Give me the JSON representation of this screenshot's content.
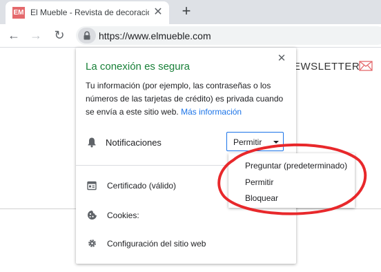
{
  "browser": {
    "tab": {
      "favicon_text": "EM",
      "title": "El Mueble - Revista de decoración",
      "close_glyph": "✕"
    },
    "new_tab_glyph": "+",
    "nav": {
      "back_glyph": "←",
      "forward_glyph": "→",
      "reload_glyph": "↻"
    },
    "url": "https://www.elmueble.com"
  },
  "page": {
    "newsletter_text": "EWSLETTER"
  },
  "popup": {
    "close_glyph": "✕",
    "title": "La conexión es segura",
    "description": "Tu información (por ejemplo, las contraseñas o los números de las tarjetas de crédito) es privada cuando se envía a este sitio web. ",
    "more_info_link": "Más información",
    "notifications_label": "Notificaciones",
    "notifications_value": "Permitir",
    "certificate_label": "Certificado (válido)",
    "cookies_label": "Cookies:",
    "site_settings_label": "Configuración del sitio web"
  },
  "dropdown": {
    "options": [
      "Preguntar (predeterminado)",
      "Permitir",
      "Bloquear"
    ]
  },
  "colors": {
    "secure_green": "#188038",
    "link_blue": "#1a73e8",
    "annotation_red": "#e8282b",
    "favicon_red": "#e4696c"
  }
}
